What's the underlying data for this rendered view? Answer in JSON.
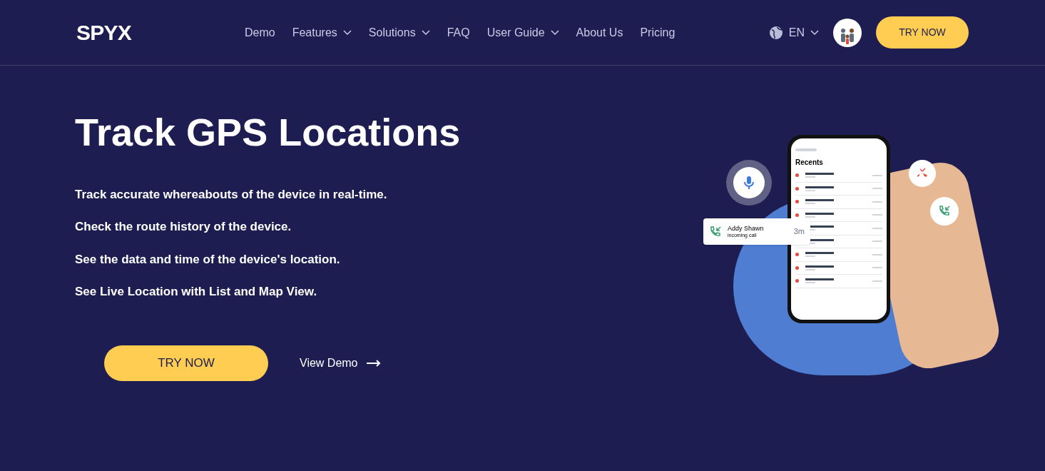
{
  "header": {
    "logo": "SPYX",
    "nav": [
      {
        "label": "Demo",
        "has_menu": false
      },
      {
        "label": "Features",
        "has_menu": true
      },
      {
        "label": "Solutions",
        "has_menu": true
      },
      {
        "label": "FAQ",
        "has_menu": false
      },
      {
        "label": "User Guide",
        "has_menu": true
      },
      {
        "label": "About Us",
        "has_menu": false
      },
      {
        "label": "Pricing",
        "has_menu": false
      }
    ],
    "language": "EN",
    "cta": "TRY NOW"
  },
  "hero": {
    "title": "Track GPS Locations",
    "points": [
      "Track accurate whereabouts of the device in real-time.",
      "Check the route history of the device.",
      "See the data and time of the device's location.",
      "See Live Location with List and Map View."
    ],
    "primary_button": "TRY NOW",
    "secondary_link": "View Demo"
  },
  "phone": {
    "heading": "Recents"
  },
  "notification": {
    "name": "Addy Shawn",
    "detail": "incoming call",
    "duration": "3m"
  }
}
